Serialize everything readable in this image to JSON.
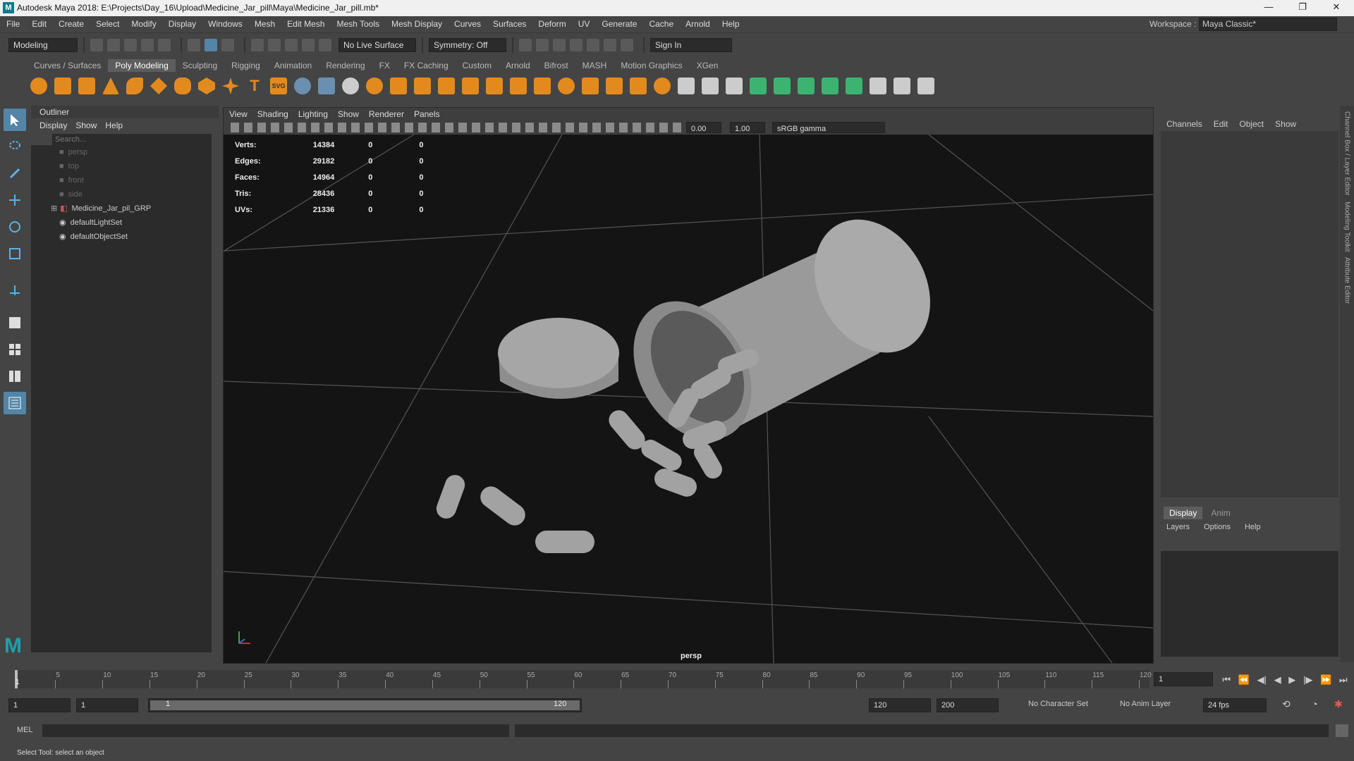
{
  "window": {
    "title": "Autodesk Maya 2018: E:\\Projects\\Day_16\\Upload\\Medicine_Jar_pill\\Maya\\Medicine_Jar_pill.mb*",
    "controls": [
      "—",
      "❐",
      "✕"
    ]
  },
  "menubar": {
    "items": [
      "File",
      "Edit",
      "Create",
      "Select",
      "Modify",
      "Display",
      "Windows",
      "Mesh",
      "Edit Mesh",
      "Mesh Tools",
      "Mesh Display",
      "Curves",
      "Surfaces",
      "Deform",
      "UV",
      "Generate",
      "Cache",
      "Arnold",
      "Help"
    ],
    "workspace_label": "Workspace :",
    "workspace_value": "Maya Classic*"
  },
  "statusline": {
    "mode": "Modeling",
    "live_surface": "No Live Surface",
    "symmetry": "Symmetry: Off",
    "sign_in": "Sign In"
  },
  "shelf": {
    "tabs": [
      "Curves / Surfaces",
      "Poly Modeling",
      "Sculpting",
      "Rigging",
      "Animation",
      "Rendering",
      "FX",
      "FX Caching",
      "Custom",
      "Arnold",
      "Bifrost",
      "MASH",
      "Motion Graphics",
      "XGen"
    ],
    "active_tab": "Poly Modeling"
  },
  "outliner": {
    "title": "Outliner",
    "menus": [
      "Display",
      "Show",
      "Help"
    ],
    "search_placeholder": "Search...",
    "items": [
      {
        "label": "persp",
        "dim": true
      },
      {
        "label": "top",
        "dim": true
      },
      {
        "label": "front",
        "dim": true
      },
      {
        "label": "side",
        "dim": true
      },
      {
        "label": "Medicine_Jar_pil_GRP",
        "dim": false
      },
      {
        "label": "defaultLightSet",
        "dim": false
      },
      {
        "label": "defaultObjectSet",
        "dim": false
      }
    ]
  },
  "viewport": {
    "menus": [
      "View",
      "Shading",
      "Lighting",
      "Show",
      "Renderer",
      "Panels"
    ],
    "exposure": "0.00",
    "gamma": "1.00",
    "color_space": "sRGB gamma",
    "camera": "persp",
    "hud": [
      {
        "label": "Verts:",
        "a": "14384",
        "b": "0",
        "c": "0"
      },
      {
        "label": "Edges:",
        "a": "29182",
        "b": "0",
        "c": "0"
      },
      {
        "label": "Faces:",
        "a": "14964",
        "b": "0",
        "c": "0"
      },
      {
        "label": "Tris:",
        "a": "28436",
        "b": "0",
        "c": "0"
      },
      {
        "label": "UVs:",
        "a": "21336",
        "b": "0",
        "c": "0"
      }
    ]
  },
  "channelbox": {
    "menus": [
      "Channels",
      "Edit",
      "Object",
      "Show"
    ]
  },
  "layers": {
    "tabs": [
      "Display",
      "Anim"
    ],
    "menus": [
      "Layers",
      "Options",
      "Help"
    ]
  },
  "side_tabs": [
    "Channel Box / Layer Editor",
    "Modeling Toolkit",
    "Attribute Editor"
  ],
  "timeslider": {
    "ticks": [
      "5",
      "10",
      "15",
      "20",
      "25",
      "30",
      "35",
      "40",
      "45",
      "50",
      "55",
      "60",
      "65",
      "70",
      "75",
      "80",
      "85",
      "90",
      "95",
      "100",
      "105",
      "110",
      "115",
      "120"
    ],
    "current_frame": "1",
    "current_frame_field": "1"
  },
  "range": {
    "start": "1",
    "playback_start": "1",
    "slider_start": "1",
    "slider_end": "120",
    "playback_end": "120",
    "end": "200",
    "character_set": "No Character Set",
    "anim_layer": "No Anim Layer",
    "fps": "24 fps"
  },
  "cmdline": {
    "label": "MEL"
  },
  "helpline": {
    "text": "Select Tool: select an object"
  },
  "colors": {
    "accent": "#5285a6",
    "viewport_bg": "#141414",
    "panel_bg": "#444444"
  }
}
